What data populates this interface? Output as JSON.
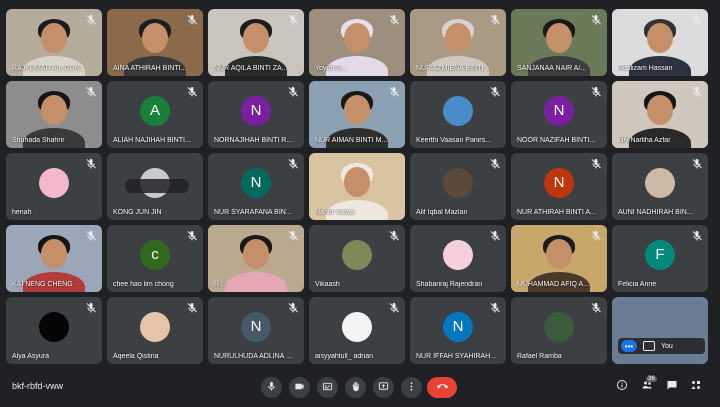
{
  "meeting": {
    "code": "bkf-rbfd-vww",
    "participant_count": "36"
  },
  "colors": {
    "background": "#202124",
    "tile": "#3c4043",
    "end_call": "#ea4335",
    "accent": "#1a73e8"
  },
  "tiles": [
    {
      "name": "RAJKUMAR A/L GUN...",
      "type": "video",
      "bg": "#b5ab9a",
      "shirt": "#d8d4c8",
      "hair": "#1d1d1d",
      "muted": true
    },
    {
      "name": "AINA ATHIRAH BINTI...",
      "type": "video",
      "bg": "#8a6a4a",
      "shirt": "#3a3a3a",
      "hair": "#1e1e1e",
      "muted": true
    },
    {
      "name": "NUR AQILA BINTI ZA...",
      "type": "video",
      "bg": "#c9c4bd",
      "shirt": "#2c2c2c",
      "hair": "#1c1c1c",
      "muted": true
    },
    {
      "name": "Yoyon S...",
      "type": "video",
      "bg": "#9c8f7d",
      "shirt": "#e4d9e6",
      "hair": "#e9dfe8",
      "muted": true
    },
    {
      "name": "NUR AZMIENA BINTI...",
      "type": "video",
      "bg": "#a99a86",
      "shirt": "#cfc7c0",
      "hair": "#d9d3cf",
      "muted": true
    },
    {
      "name": "SANJANAA NAIR A/...",
      "type": "video",
      "bg": "#6a7a58",
      "shirt": "#3d3d3d",
      "hair": "#181818",
      "muted": true
    },
    {
      "name": "Roslizam Hassan",
      "type": "video",
      "bg": "#dcdcdc",
      "shirt": "#2d3440",
      "hair": "#333",
      "muted": true
    },
    {
      "name": "Shuhada Shahrir",
      "type": "video",
      "bg": "#8d8d8d",
      "shirt": "#3a3a3a",
      "hair": "#151515",
      "muted": true
    },
    {
      "name": "ALIAH NAJIHAH BINTI...",
      "type": "letter",
      "letter": "A",
      "color": "#188038",
      "muted": true
    },
    {
      "name": "NORNAJIHAH BINTI R...",
      "type": "letter",
      "letter": "N",
      "color": "#7b1fa2",
      "muted": true
    },
    {
      "name": "NUR AIMAN BINTI M...",
      "type": "video",
      "bg": "#8ba0b0",
      "shirt": "#2e2e2e",
      "hair": "#1a1a1a",
      "muted": true
    },
    {
      "name": "Keerthi Vaasan Panirs...",
      "type": "picture",
      "pic": "#4a8cc9",
      "muted": true
    },
    {
      "name": "NOOR NAZIFAH BINTI...",
      "type": "letter",
      "letter": "N",
      "color": "#7b1fa2",
      "muted": true
    },
    {
      "name": "Lily Narliha Azfar",
      "type": "video",
      "bg": "#cfc6bd",
      "shirt": "#2a2a2a",
      "hair": "#161616",
      "muted": true
    },
    {
      "name": "henah",
      "type": "picture",
      "pic": "#f2b8cc",
      "muted": true
    },
    {
      "name": "KONG JUN JIN",
      "type": "picture",
      "pic": "#c9c9c9",
      "muted": false,
      "pinned": true
    },
    {
      "name": "NUR SYARAFANA BIN...",
      "type": "letter",
      "letter": "N",
      "color": "#00695c",
      "muted": true
    },
    {
      "name": "Nahid Yahya",
      "type": "video",
      "bg": "#d9c4a2",
      "shirt": "#ede7df",
      "hair": "#efe8e2",
      "muted": false
    },
    {
      "name": "Alif Iqbal Mazlan",
      "type": "picture",
      "pic": "#5b4a3a",
      "muted": true
    },
    {
      "name": "NUR ATHIRAH BINTI A...",
      "type": "letter",
      "letter": "N",
      "color": "#bf360c",
      "muted": true
    },
    {
      "name": "AUNI NADHIRAH BIN...",
      "type": "picture",
      "pic": "#cdb9a8",
      "muted": true
    },
    {
      "name": "KAI NENG CHENG",
      "type": "video",
      "bg": "#9ba7b8",
      "shirt": "#b23b3b",
      "hair": "#151515",
      "muted": true
    },
    {
      "name": "chee hao lim chong",
      "type": "letter",
      "letter": "c",
      "color": "#33691e",
      "muted": true
    },
    {
      "name": "R...",
      "type": "video",
      "bg": "#b9a98f",
      "shirt": "#e6a7b7",
      "hair": "#1a1a1a",
      "muted": true
    },
    {
      "name": "Vikaash",
      "type": "picture",
      "pic": "#7c8a5a",
      "muted": true
    },
    {
      "name": "Shabariraj Rajendran",
      "type": "picture",
      "pic": "#f5d0dc",
      "muted": true
    },
    {
      "name": "MUHAMMAD AFIQ A...",
      "type": "video",
      "bg": "#c7a86a",
      "shirt": "#4a3a2a",
      "hair": "#1b1b1b",
      "muted": true
    },
    {
      "name": "Felicia Anne",
      "type": "letter",
      "letter": "F",
      "color": "#00897b",
      "muted": true
    },
    {
      "name": "Alya Asyura",
      "type": "picture",
      "pic": "#050505",
      "muted": true
    },
    {
      "name": "Aqeela Qistina",
      "type": "picture",
      "pic": "#e7c3a7",
      "muted": true
    },
    {
      "name": "NURULHUDA ADLINA ...",
      "type": "letter",
      "letter": "N",
      "color": "#455a64",
      "muted": true
    },
    {
      "name": "aisyyahtull_ adnan",
      "type": "picture",
      "pic": "#f3f3f3",
      "muted": true
    },
    {
      "name": "NUR IFFAH SYAHIRAH...",
      "type": "letter",
      "letter": "N",
      "color": "#0277bd",
      "muted": true
    },
    {
      "name": "Rafael Ramba",
      "type": "picture",
      "pic": "#3c5a3c",
      "muted": true
    },
    {
      "name": "You",
      "type": "self",
      "pic": "#6a7d94",
      "muted": false
    }
  ],
  "controls": [
    {
      "icon": "microphone-icon"
    },
    {
      "icon": "camera-icon"
    },
    {
      "icon": "captions-icon"
    },
    {
      "icon": "raise-hand-icon"
    },
    {
      "icon": "present-icon"
    },
    {
      "icon": "more-options-icon"
    },
    {
      "icon": "end-call-icon"
    }
  ],
  "side_controls": [
    {
      "icon": "info-icon"
    },
    {
      "icon": "people-icon"
    },
    {
      "icon": "chat-icon"
    },
    {
      "icon": "activities-icon"
    }
  ],
  "self_tile": {
    "label": "You",
    "more": "•••"
  }
}
